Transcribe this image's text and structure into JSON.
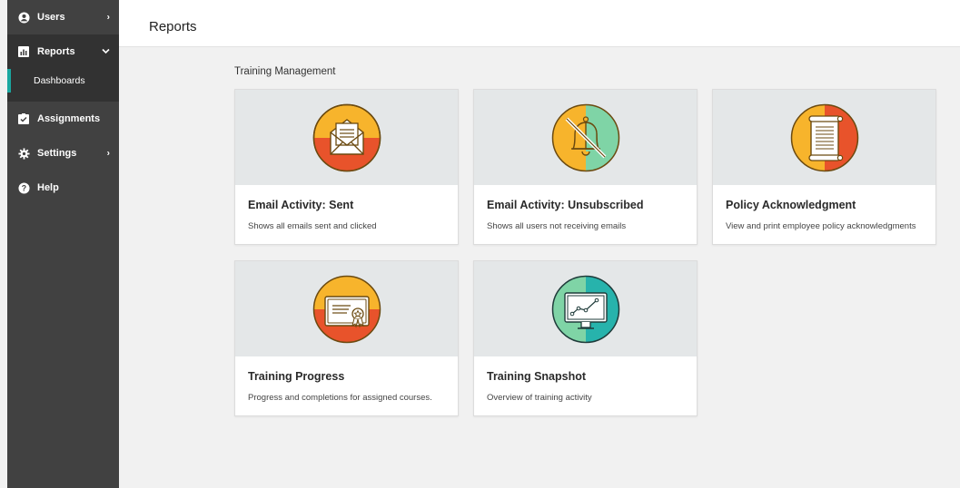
{
  "sidebar": {
    "items": [
      {
        "label": "Users",
        "icon": "user-circle-icon",
        "chevron": "›"
      },
      {
        "label": "Reports",
        "icon": "bar-chart-icon",
        "chevron": "⌄",
        "expanded": true,
        "subitems": [
          {
            "label": "Dashboards",
            "active": true
          }
        ]
      },
      {
        "label": "Assignments",
        "icon": "checklist-icon"
      },
      {
        "label": "Settings",
        "icon": "gear-icon",
        "chevron": "›"
      },
      {
        "label": "Help",
        "icon": "help-icon"
      }
    ]
  },
  "header": {
    "title": "Reports"
  },
  "main": {
    "section_title": "Training Management",
    "cards": [
      {
        "title": "Email Activity: Sent",
        "description": "Shows all emails sent and clicked",
        "icon": "envelope-icon"
      },
      {
        "title": "Email Activity: Unsubscribed",
        "description": "Shows all users not receiving emails",
        "icon": "bell-muted-icon"
      },
      {
        "title": "Policy Acknowledgment",
        "description": "View and print employee policy acknowledgments",
        "icon": "scroll-icon"
      },
      {
        "title": "Training Progress",
        "description": "Progress and completions for assigned courses.",
        "icon": "certificate-icon"
      },
      {
        "title": "Training Snapshot",
        "description": "Overview of training activity",
        "icon": "monitor-chart-icon"
      }
    ]
  },
  "colors": {
    "sidebar_bg": "#414141",
    "sidebar_active_bg": "#323232",
    "accent_teal": "#1aa7a0",
    "orange": "#f7b42c",
    "red_orange": "#e8532b",
    "mint": "#7fd4a6",
    "teal": "#27b3ac"
  }
}
